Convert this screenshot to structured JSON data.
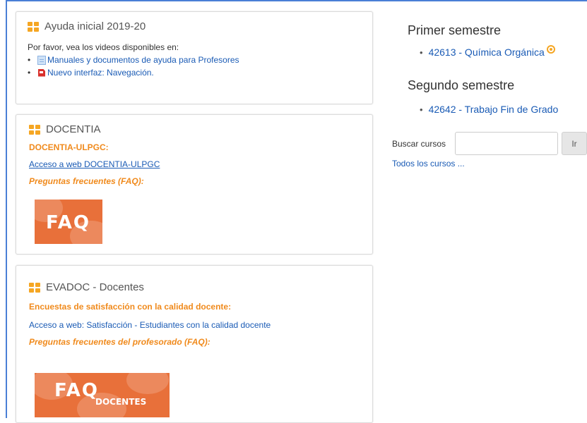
{
  "colors": {
    "accent_orange": "#f08a1c",
    "link_blue": "#1a5bb5",
    "faq_orange": "#e8703a",
    "frame_blue": "#4a7fd6"
  },
  "ayuda": {
    "title": "Ayuda inicial 2019-20",
    "intro": "Por favor, vea los videos disponibles en:",
    "links": [
      {
        "label": "Manuales y documentos de ayuda para Profesores",
        "icon": "document-icon"
      },
      {
        "label": "Nuevo interfaz: Navegación.",
        "icon": "pdf-icon"
      }
    ]
  },
  "docentia": {
    "title": "DOCENTIA",
    "subtitle": "DOCENTIA-ULPGC:",
    "link": "Acceso a web DOCENTIA-ULPGC",
    "faq_heading": "Preguntas frecuentes (FAQ):",
    "faq_image_text": "FAQ"
  },
  "evadoc": {
    "title": "EVADOC - Docentes",
    "subtitle": "Encuestas de satisfacción con la calidad docente:",
    "link": "Acceso a web: Satisfacción - Estudiantes con la calidad docente",
    "faq_heading": "Preguntas frecuentes del profesorado (FAQ):",
    "faq_image_text": "FAQ",
    "faq_image_subtext": "DOCENTES"
  },
  "courses": {
    "first_semester": {
      "title": "Primer semestre",
      "items": [
        "42613 - Química Orgánica"
      ]
    },
    "second_semester": {
      "title": "Segundo semestre",
      "items": [
        "42642 - Trabajo Fin de Grado"
      ]
    }
  },
  "search": {
    "label": "Buscar cursos",
    "value": "",
    "button": "Ir",
    "all_courses": "Todos los cursos ..."
  }
}
